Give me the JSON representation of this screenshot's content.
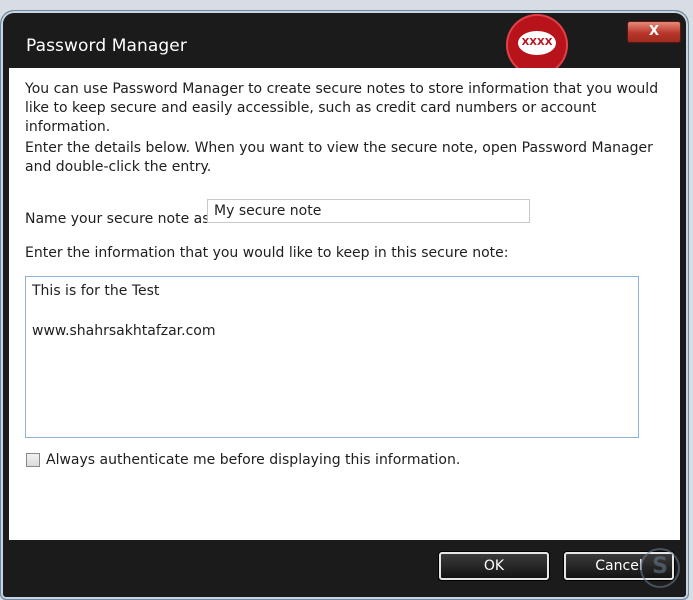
{
  "window": {
    "title": "Password Manager",
    "close_label": "X"
  },
  "badge": {
    "text": "XXXX"
  },
  "content": {
    "intro": "You can use Password Manager to create secure notes to store information that you would like to keep secure and easily accessible, such as credit card numbers or account information.",
    "instructions": "Enter the details below. When you want to view the secure note, open Password Manager and double-click the entry.",
    "name_label": "Name your secure note as:",
    "name_value": "My secure note",
    "info_label": "Enter the information that you would like to keep in this secure note:",
    "note_text": "This is for the Test\n\nwww.shahrsakhtafzar.com",
    "checkbox_label": "Always authenticate me before displaying this information.",
    "checkbox_checked": false
  },
  "buttons": {
    "ok": "OK",
    "cancel": "Cancel"
  },
  "watermark": {
    "glyph": "S"
  },
  "colors": {
    "frame": "#1b1b1b",
    "close": "#b9372a",
    "badge": "#b8121b",
    "focus_border": "#8fb3d4"
  }
}
